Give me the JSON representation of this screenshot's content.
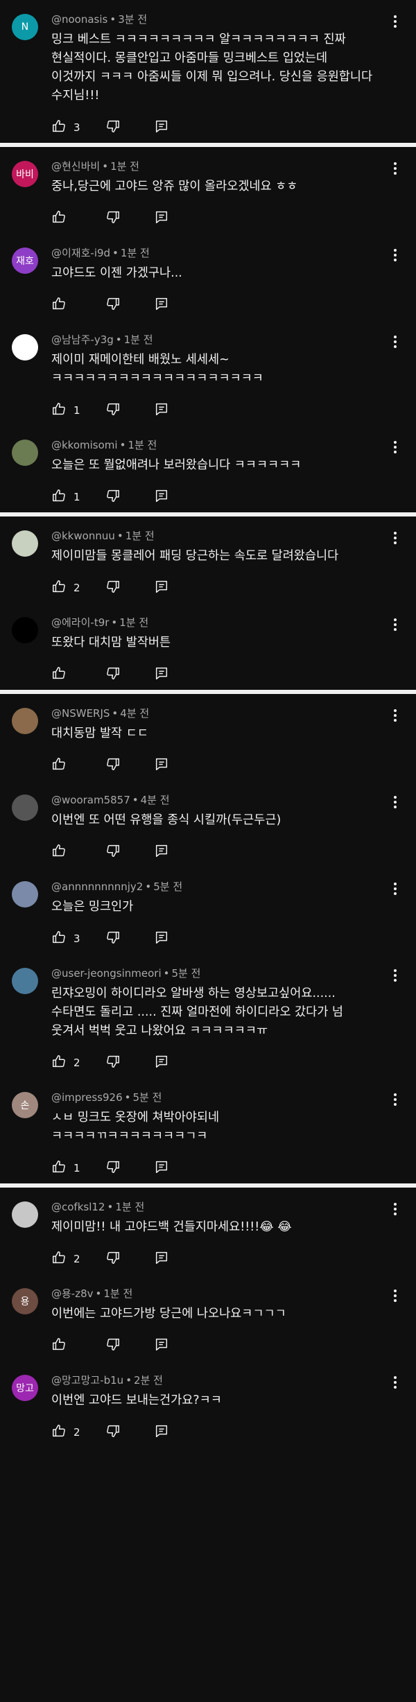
{
  "groups": [
    [
      {
        "author": "@noonasis",
        "time": "3분 전",
        "text": "밍크 베스트 ㅋㅋㅋㅋㅋㅋㅋㅋㅋ 알ㅋㅋㅋㅋㅋㅋㅋㅋ 진짜 현실적이다. 몽클안입고 아줌마들 밍크베스트 입었는데 이것까지 ㅋㅋㅋ 아줌씨들 이제 뭐 입으려나. 당신을 응원합니다 수지님!!!",
        "likes": "3",
        "avatar_text": "N",
        "avatar_color": "#0c9aa9"
      }
    ],
    [
      {
        "author": "@현신바비",
        "time": "1분 전",
        "text": "중나,당근에 고야드 앙쥬 많이 올라오겠네요 ㅎㅎ",
        "likes": "",
        "avatar_text": "바비",
        "avatar_color": "#c2185b"
      },
      {
        "author": "@이재호-i9d",
        "time": "1분 전",
        "text": "고야드도 이젠 가겠구나...",
        "likes": "",
        "avatar_text": "재호",
        "avatar_color": "#8e3dc6"
      },
      {
        "author": "@남남주-y3g",
        "time": "1분 전",
        "text": "제이미 재메이한테 배웠노 세세세~ ㅋㅋㅋㅋㅋㅋㅋㅋㅋㅋㅋㅋㅋㅋㅋㅋㅋㅋㅋ",
        "likes": "1",
        "avatar_text": "",
        "avatar_color": "#ffffff"
      },
      {
        "author": "@kkomisomi",
        "time": "1분 전",
        "text": "오늘은 또 뭘없애려나 보러왔습니다 ㅋㅋㅋㅋㅋㅋ",
        "likes": "1",
        "avatar_text": "",
        "avatar_color": "#6b7b52"
      }
    ],
    [
      {
        "author": "@kkwonnuu",
        "time": "1분 전",
        "text": "제이미맘들 몽클레어 패딩 당근하는 속도로 달려왔습니다",
        "likes": "2",
        "avatar_text": "",
        "avatar_color": "#c8d0c0"
      },
      {
        "author": "@에라이-t9r",
        "time": "1분 전",
        "text": "또왔다 대치맘 발작버튼",
        "likes": "",
        "avatar_text": "",
        "avatar_color": "#000000"
      }
    ],
    [
      {
        "author": "@NSWERJS",
        "time": "4분 전",
        "text": "대치동맘 발작 ㄷㄷ",
        "likes": "",
        "avatar_text": "",
        "avatar_color": "#8a6a4a"
      },
      {
        "author": "@wooram5857",
        "time": "4분 전",
        "text": "이번엔 또 어떤 유행을 종식 시킬까(두근두근)",
        "likes": "",
        "avatar_text": "",
        "avatar_color": "#555555"
      },
      {
        "author": "@annnnnnnnnjy2",
        "time": "5분 전",
        "text": "오늘은 밍크인가",
        "likes": "3",
        "avatar_text": "",
        "avatar_color": "#7a8aa8"
      },
      {
        "author": "@user-jeongsinmeori",
        "time": "5분 전",
        "text": "린쟈오밍이 하이디라오 알바생 하는 영상보고싶어요...... 수타면도 돌리고 ..... 진짜 얼마전에 하이디라오 갔다가 넘 웃겨서 벅벅 웃고 나왔어요 ㅋㅋㅋㅋㅋㅋㅠ",
        "likes": "2",
        "avatar_text": "",
        "avatar_color": "#4a7a9a"
      },
      {
        "author": "@impress926",
        "time": "5분 전",
        "text": "ㅅㅂ 밍크도 옷장에 쳐박아야되네 ㅋㅋㅋㅋㄲㅋㅋㅋㅋㅋㅋㅋㄱㅋ",
        "likes": "1",
        "avatar_text": "손",
        "avatar_color": "#a1887f"
      }
    ],
    [
      {
        "author": "@cofksl12",
        "time": "1분 전",
        "text": "제이미맘!!  내 고야드백 건들지마세요!!!!😂 😂",
        "likes": "2",
        "avatar_text": "",
        "avatar_color": "#c7c7c7"
      },
      {
        "author": "@용-z8v",
        "time": "1분 전",
        "text": "이번에는 고야드가방 당근에 나오나요ㅋㄱㄱㄱ",
        "likes": "",
        "avatar_text": "용",
        "avatar_color": "#6d4c41"
      },
      {
        "author": "@망고망고-b1u",
        "time": "2분 전",
        "text": "이번엔 고야드 보내는건가요?ㅋㅋ",
        "likes": "2",
        "avatar_text": "망고",
        "avatar_color": "#9c27b0"
      }
    ]
  ]
}
